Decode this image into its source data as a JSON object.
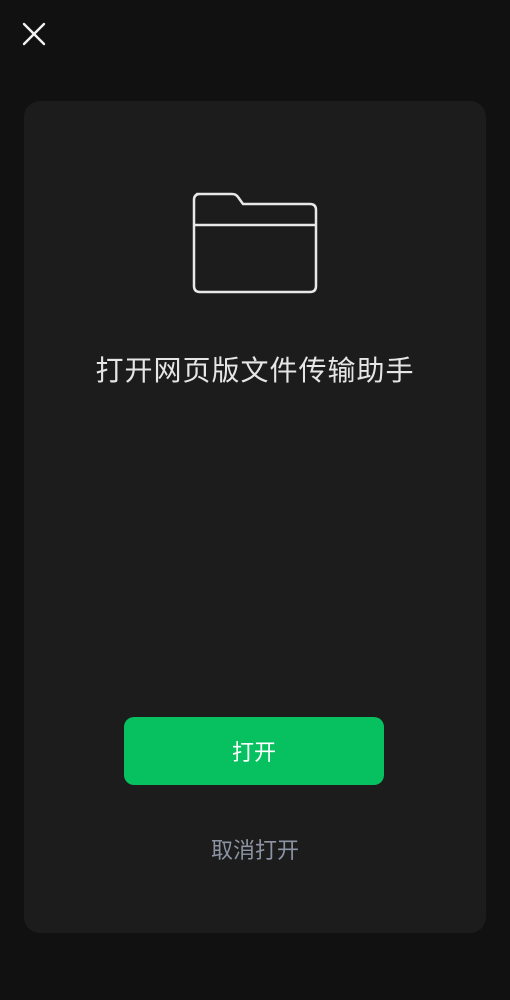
{
  "header": {
    "close_icon": "close-icon"
  },
  "dialog": {
    "icon": "folder-icon",
    "title": "打开网页版文件传输助手",
    "open_label": "打开",
    "cancel_label": "取消打开"
  },
  "colors": {
    "background": "#111111",
    "card": "#1c1c1c",
    "accent": "#07c160",
    "cancel_text": "#8c93a3",
    "title_text": "#e6e6e6"
  }
}
